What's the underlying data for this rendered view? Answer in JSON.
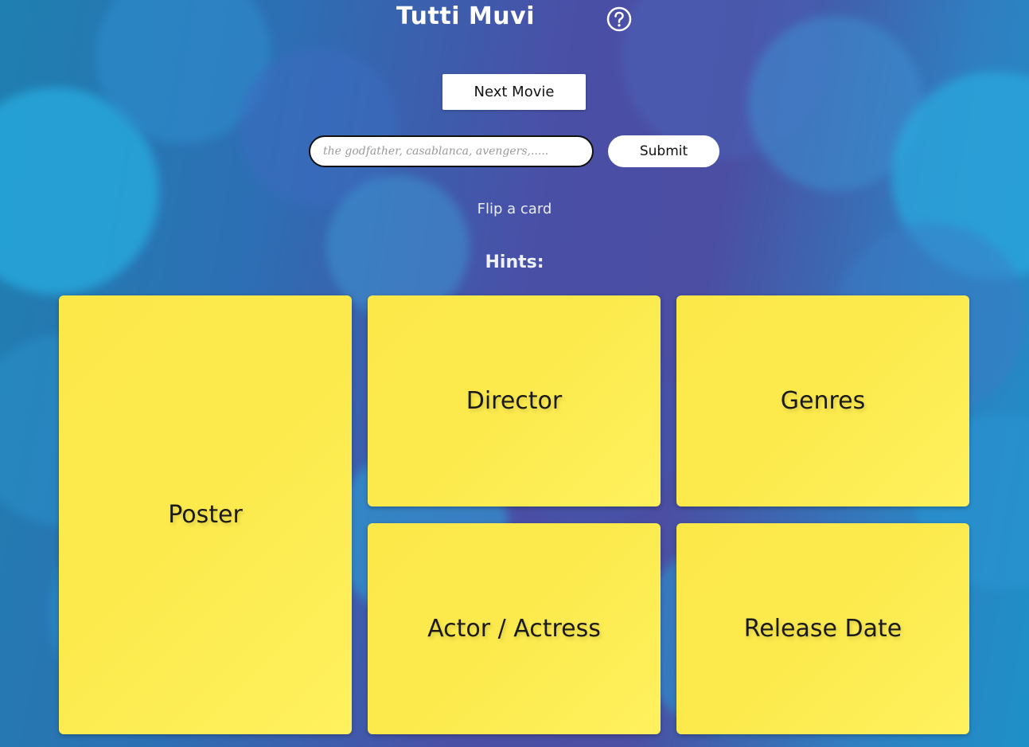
{
  "header": {
    "title": "Tutti Muvi",
    "help_icon": "question-circle-icon"
  },
  "controls": {
    "next_movie_label": "Next Movie",
    "search_placeholder": "the godfather, casablanca, avengers,.....",
    "search_value": "",
    "submit_label": "Submit"
  },
  "status": {
    "message": "Flip a card"
  },
  "hints": {
    "heading": "Hints:",
    "cards": [
      {
        "label": "Poster"
      },
      {
        "label": "Director"
      },
      {
        "label": "Genres"
      },
      {
        "label": "Actor / Actress"
      },
      {
        "label": "Release Date"
      }
    ]
  },
  "colors": {
    "card": "#fcea4d",
    "background": "#4a4fa6",
    "button": "#ffffff"
  }
}
